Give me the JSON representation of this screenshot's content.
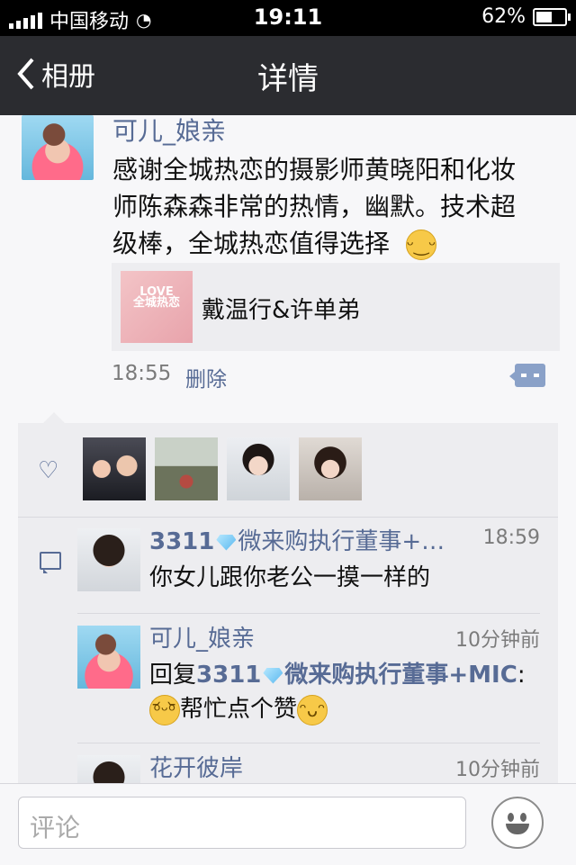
{
  "status_bar": {
    "carrier": "中国移动",
    "time": "19:11",
    "battery_percent": "62%",
    "battery_level": 0.62
  },
  "nav": {
    "back_label": "相册",
    "title": "详情"
  },
  "post": {
    "author": "可儿_娘亲",
    "text": "感谢全城热恋的摄影师黄晓阳和化妆师陈森森非常的热情，幽默。技术超级棒，全城热恋值得选择",
    "link_card": {
      "thumb_caption": "LOVE\n全城热恋",
      "title": "戴温行&许单弟"
    },
    "time": "18:55",
    "delete_label": "删除"
  },
  "comments": [
    {
      "author_prefix": "3311",
      "author_suffix": "微来购执行董事+…",
      "time": "18:59",
      "text": "你女儿跟你老公一摸一样的"
    },
    {
      "author": "可儿_娘亲",
      "time": "10分钟前",
      "reply_prefix": "回复",
      "reply_to_a": "3311",
      "reply_to_b": "微来购执行董事+MIC",
      "text": "帮忙点个赞"
    },
    {
      "author": "花开彼岸",
      "time": "10分钟前"
    }
  ],
  "composer": {
    "placeholder": "评论"
  },
  "icons": [
    "signal-icon",
    "wifi-icon",
    "battery-icon",
    "back-chevron-icon",
    "heart-icon",
    "comment-icon",
    "smile-icon",
    "diamond-icon"
  ],
  "colors": {
    "nav_bg": "#2b2c30",
    "link": "#576b95",
    "page_bg": "#f7f7f9"
  }
}
